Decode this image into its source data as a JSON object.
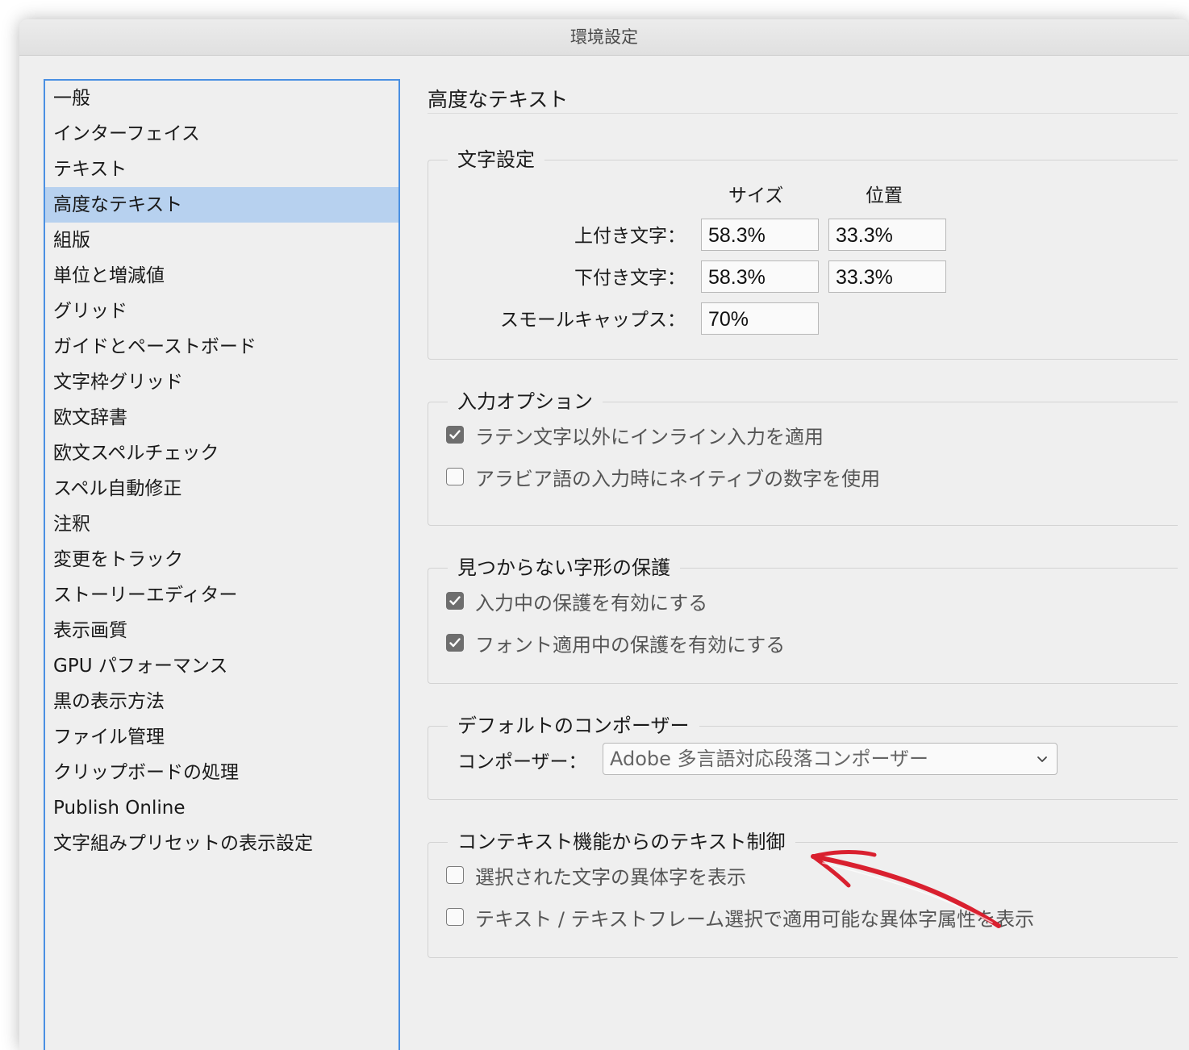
{
  "window": {
    "title": "環境設定"
  },
  "sidebar": {
    "items": [
      {
        "label": "一般",
        "selected": false
      },
      {
        "label": "インターフェイス",
        "selected": false
      },
      {
        "label": "テキスト",
        "selected": false
      },
      {
        "label": "高度なテキスト",
        "selected": true
      },
      {
        "label": "組版",
        "selected": false
      },
      {
        "label": "単位と増減値",
        "selected": false
      },
      {
        "label": "グリッド",
        "selected": false
      },
      {
        "label": "ガイドとペーストボード",
        "selected": false
      },
      {
        "label": "文字枠グリッド",
        "selected": false
      },
      {
        "label": "欧文辞書",
        "selected": false
      },
      {
        "label": "欧文スペルチェック",
        "selected": false
      },
      {
        "label": "スペル自動修正",
        "selected": false
      },
      {
        "label": "注釈",
        "selected": false
      },
      {
        "label": "変更をトラック",
        "selected": false
      },
      {
        "label": "ストーリーエディター",
        "selected": false
      },
      {
        "label": "表示画質",
        "selected": false
      },
      {
        "label": "GPU パフォーマンス",
        "selected": false
      },
      {
        "label": "黒の表示方法",
        "selected": false
      },
      {
        "label": "ファイル管理",
        "selected": false
      },
      {
        "label": "クリップボードの処理",
        "selected": false
      },
      {
        "label": "Publish Online",
        "selected": false
      },
      {
        "label": "文字組みプリセットの表示設定",
        "selected": false
      }
    ]
  },
  "panel": {
    "title": "高度なテキスト",
    "char_settings": {
      "legend": "文字設定",
      "col_size": "サイズ",
      "col_position": "位置",
      "rows": [
        {
          "label": "上付き文字：",
          "size": "58.3%",
          "position": "33.3%"
        },
        {
          "label": "下付き文字：",
          "size": "58.3%",
          "position": "33.3%"
        },
        {
          "label": "スモールキャップス：",
          "size": "70%"
        }
      ]
    },
    "input_options": {
      "legend": "入力オプション",
      "items": [
        {
          "label": "ラテン文字以外にインライン入力を適用",
          "checked": true
        },
        {
          "label": "アラビア語の入力時にネイティブの数字を使用",
          "checked": false
        }
      ]
    },
    "missing_glyph": {
      "legend": "見つからない字形の保護",
      "items": [
        {
          "label": "入力中の保護を有効にする",
          "checked": true
        },
        {
          "label": "フォント適用中の保護を有効にする",
          "checked": true
        }
      ]
    },
    "default_composer": {
      "legend": "デフォルトのコンポーザー",
      "label": "コンポーザー：",
      "value": "Adobe 多言語対応段落コンポーザー"
    },
    "contextual": {
      "legend": "コンテキスト機能からのテキスト制御",
      "items": [
        {
          "label": "選択された文字の異体字を表示",
          "checked": false
        },
        {
          "label": "テキスト / テキストフレーム選択で適用可能な異体字属性を表示",
          "checked": false
        }
      ]
    }
  },
  "colors": {
    "selection": "#b7d1ef",
    "focus_ring": "#4a90e2",
    "annotation_arrow": "#d9202f"
  },
  "icons": {
    "checkbox_checked": "checkmark-icon",
    "select_chevron": "chevron-down-icon"
  }
}
